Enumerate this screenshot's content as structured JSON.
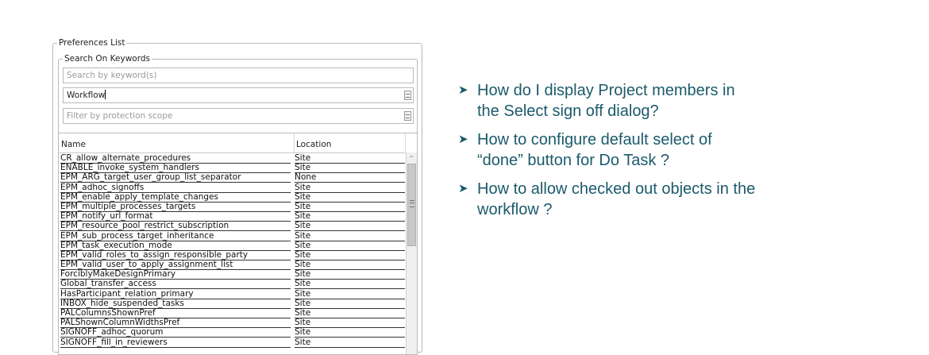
{
  "preferences_list": {
    "title": "Preferences List",
    "search_group": {
      "title": "Search On Keywords",
      "keyword_placeholder": "Search by keyword(s)",
      "category_value": "Workflow",
      "scope_placeholder": "Filter by protection scope"
    },
    "table": {
      "columns": [
        "Name",
        "Location"
      ],
      "rows": [
        {
          "name": "CR_allow_alternate_procedures",
          "location": "Site"
        },
        {
          "name": "ENABLE_invoke_system_handlers",
          "location": "Site"
        },
        {
          "name": "EPM_ARG_target_user_group_list_separator",
          "location": "None"
        },
        {
          "name": "EPM_adhoc_signoffs",
          "location": "Site"
        },
        {
          "name": "EPM_enable_apply_template_changes",
          "location": "Site"
        },
        {
          "name": "EPM_multiple_processes_targets",
          "location": "Site"
        },
        {
          "name": "EPM_notify_url_format",
          "location": "Site"
        },
        {
          "name": "EPM_resource_pool_restrict_subscription",
          "location": "Site"
        },
        {
          "name": "EPM_sub_process_target_inheritance",
          "location": "Site"
        },
        {
          "name": "EPM_task_execution_mode",
          "location": "Site"
        },
        {
          "name": "EPM_valid_roles_to_assign_responsible_party",
          "location": "Site"
        },
        {
          "name": "EPM_valid_user_to_apply_assignment_list",
          "location": "Site"
        },
        {
          "name": "ForciblyMakeDesignPrimary",
          "location": "Site"
        },
        {
          "name": "Global_transfer_access",
          "location": "Site"
        },
        {
          "name": "HasParticipant_relation_primary",
          "location": "Site"
        },
        {
          "name": "INBOX_hide_suspended_tasks",
          "location": "Site"
        },
        {
          "name": "PALColumnsShownPref",
          "location": "Site"
        },
        {
          "name": "PALShownColumnWidthsPref",
          "location": "Site"
        },
        {
          "name": "SIGNOFF_adhoc_quorum",
          "location": "Site"
        },
        {
          "name": "SIGNOFF_fill_in_reviewers",
          "location": "Site"
        }
      ]
    }
  },
  "questions": [
    "How do I display Project members in the Select sign off dialog?",
    "How to configure default select of “done” button  for Do Task ?",
    "How to allow checked out objects in the workflow ?"
  ],
  "icons": {
    "dropdown": "dropdown-icon",
    "scroll_up": "scroll-up-icon",
    "bullet": "arrow-bullet-icon"
  },
  "colors": {
    "question_text": "#1b5a6b"
  }
}
